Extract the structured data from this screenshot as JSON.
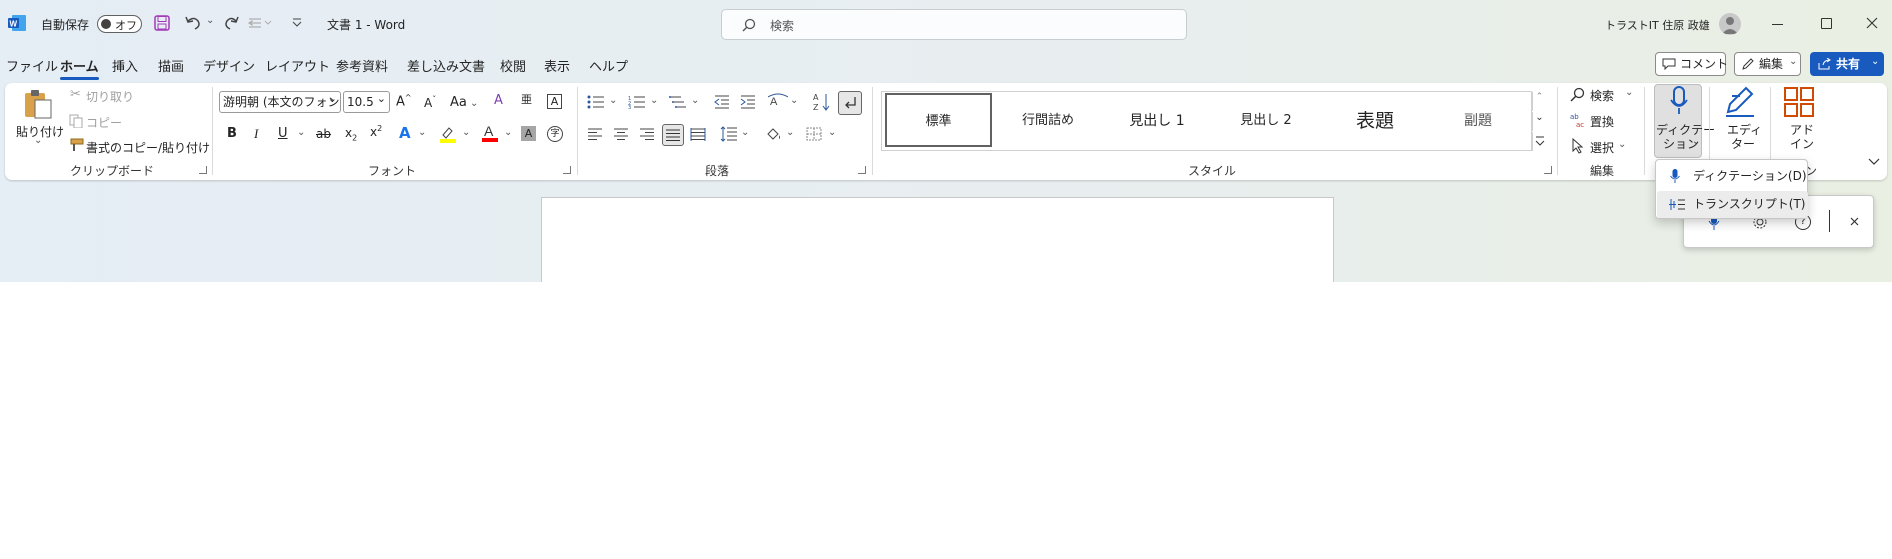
{
  "titlebar": {
    "autosave_label": "自動保存",
    "autosave_state": "オフ",
    "doc_title": "文書 1 - Word",
    "search_placeholder": "検索",
    "user_name": "トラストIT 住原 政雄"
  },
  "tabs": [
    "ファイル",
    "ホーム",
    "挿入",
    "描画",
    "デザイン",
    "レイアウト",
    "参考資料",
    "差し込み文書",
    "校閲",
    "表示",
    "ヘルプ"
  ],
  "active_tab": "ホーム",
  "top_right": {
    "comment": "コメント",
    "edit": "編集",
    "share": "共有"
  },
  "clipboard": {
    "paste": "貼り付け",
    "cut": "切り取り",
    "copy": "コピー",
    "format_painter": "書式のコピー/貼り付け",
    "group": "クリップボード"
  },
  "font": {
    "name": "游明朝 (本文のフォン",
    "size": "10.5",
    "case": "Aa",
    "group": "フォント"
  },
  "paragraph": {
    "group": "段落"
  },
  "styles": {
    "items": [
      "標準",
      "行間詰め",
      "見出し 1",
      "見出し 2",
      "表題",
      "副題"
    ],
    "group": "スタイル"
  },
  "editing": {
    "find": "検索",
    "replace": "置換",
    "select": "選択",
    "group": "編集"
  },
  "voice": {
    "dictate_l1": "ディクテー",
    "dictate_l2": "ション",
    "group_partial": "ン"
  },
  "editor": {
    "l1": "エディ",
    "l2": "ター"
  },
  "addins": {
    "l1": "アド",
    "l2": "イン"
  },
  "dictate_menu": {
    "item1": "ディクテーション(D)",
    "item2": "トランスクリプト(T)"
  },
  "colors": {
    "accent": "#185abd",
    "highlight": "#ffff00",
    "fontcolor": "#ff0000",
    "share_bg": "#185abd",
    "word_blue": "#2b579a"
  }
}
